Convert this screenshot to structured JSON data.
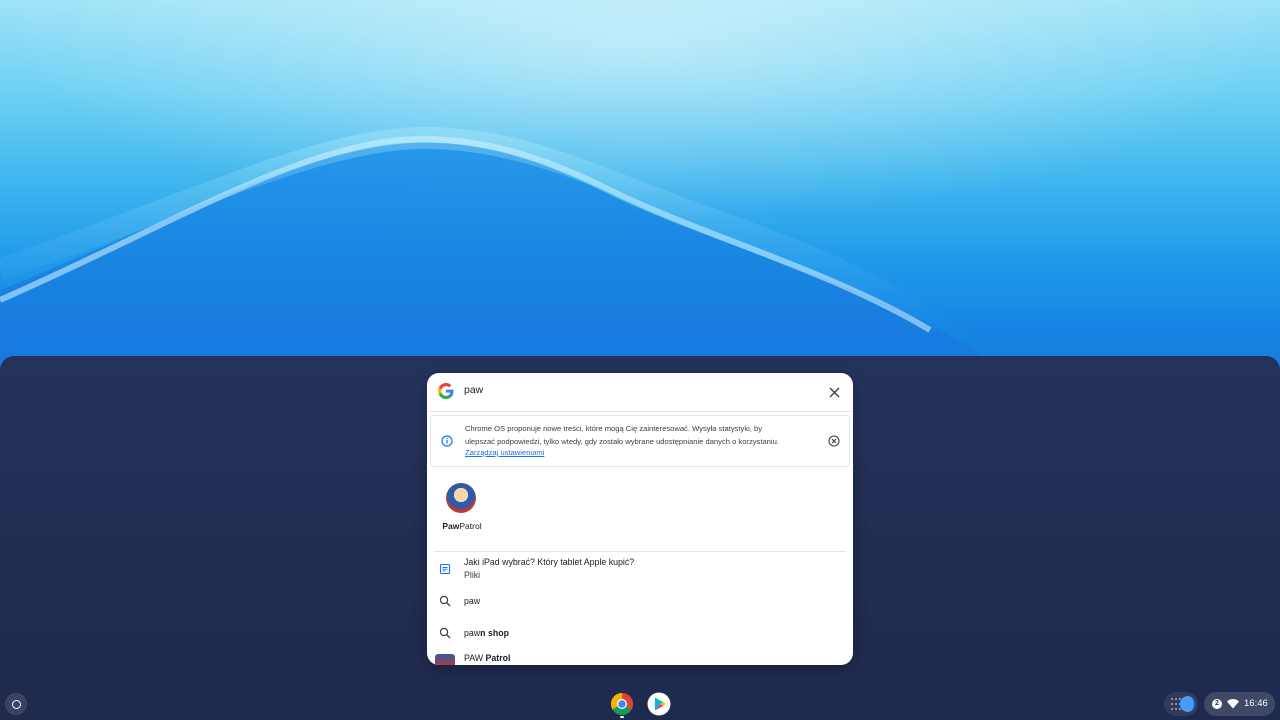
{
  "search": {
    "query": "paw"
  },
  "notice": {
    "line1": "Chrome OS proponuje nowe treści, które mogą Cię zainteresować. Wysyła statystyki, by",
    "line2": "ulepszać podpowiedzi, tylko wtedy, gdy zostało wybrane udostępnianie danych o korzystaniu.",
    "link": "Zarządzaj ustawieniami"
  },
  "apps": [
    {
      "label_bold": "Paw",
      "label_rest": "Patrol",
      "icon": "paw-patrol-app-icon"
    }
  ],
  "results": [
    {
      "icon": "file-icon",
      "title": "Jaki iPad wybrać? Który tablet Apple kupić?",
      "subtitle": "Pliki"
    },
    {
      "icon": "search-icon",
      "title": "paw"
    },
    {
      "icon": "search-icon",
      "title_plain": "paw",
      "title_bold": "n shop"
    },
    {
      "icon": "paw-patrol-app-icon",
      "title_plain": "PAW ",
      "title_bold": "Patrol"
    }
  ],
  "shelf": {
    "apps": [
      {
        "name": "chrome-browser",
        "icon": "chrome-icon"
      },
      {
        "name": "play-store",
        "icon": "play-store-icon"
      }
    ]
  },
  "tray": {
    "notification_count": "2",
    "time": "16:46"
  },
  "colors": {
    "launcher_bg": "#25335c",
    "link": "#1a73e8",
    "wallpaper_blue": "#1a7fe0"
  }
}
